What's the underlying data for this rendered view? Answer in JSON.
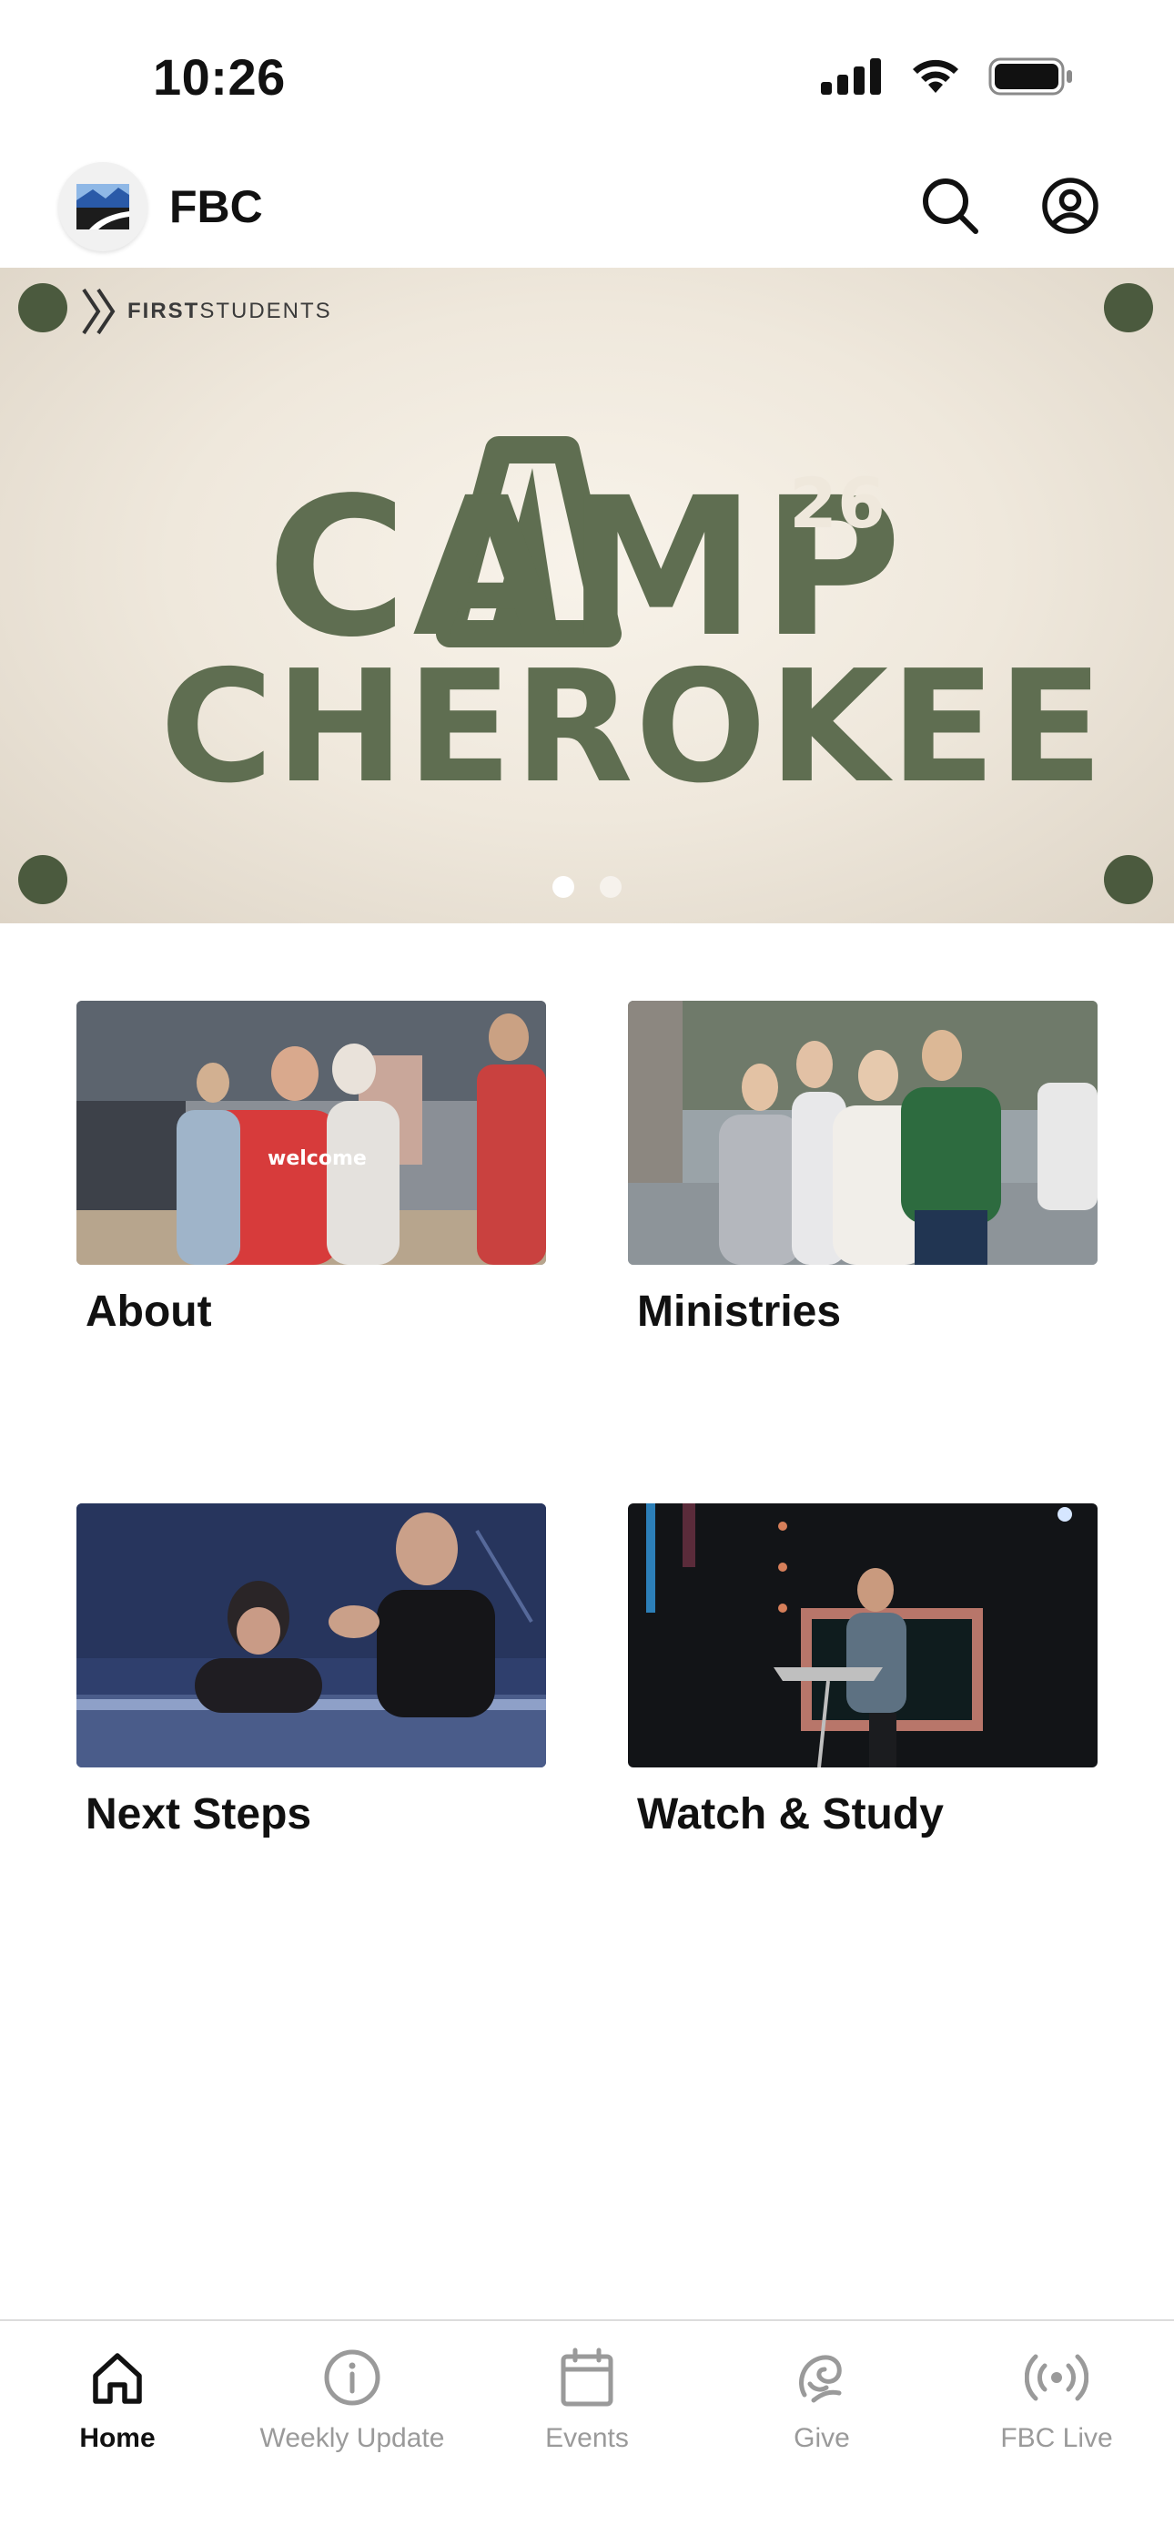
{
  "status_bar": {
    "time": "10:26"
  },
  "header": {
    "title": "FBC"
  },
  "hero": {
    "brand_bold": "FIRST",
    "brand_light": "STUDENTS",
    "headline_line1": "CAMP",
    "year": "26",
    "headline_line2": "CHEROKEE",
    "slide_count": 2,
    "active_slide": 1
  },
  "tiles": [
    {
      "label": "About"
    },
    {
      "label": "Ministries"
    },
    {
      "label": "Next Steps"
    },
    {
      "label": "Watch & Study"
    }
  ],
  "tab_bar": {
    "items": [
      {
        "label": "Home",
        "icon": "home-icon",
        "active": true
      },
      {
        "label": "Weekly Update",
        "icon": "info-icon",
        "active": false
      },
      {
        "label": "Events",
        "icon": "calendar-icon",
        "active": false
      },
      {
        "label": "Give",
        "icon": "give-icon",
        "active": false
      },
      {
        "label": "FBC Live",
        "icon": "broadcast-icon",
        "active": false
      }
    ]
  },
  "colors": {
    "camp_green": "#5f6e51",
    "tab_inactive": "#9a9a9a",
    "tab_active": "#111111"
  }
}
